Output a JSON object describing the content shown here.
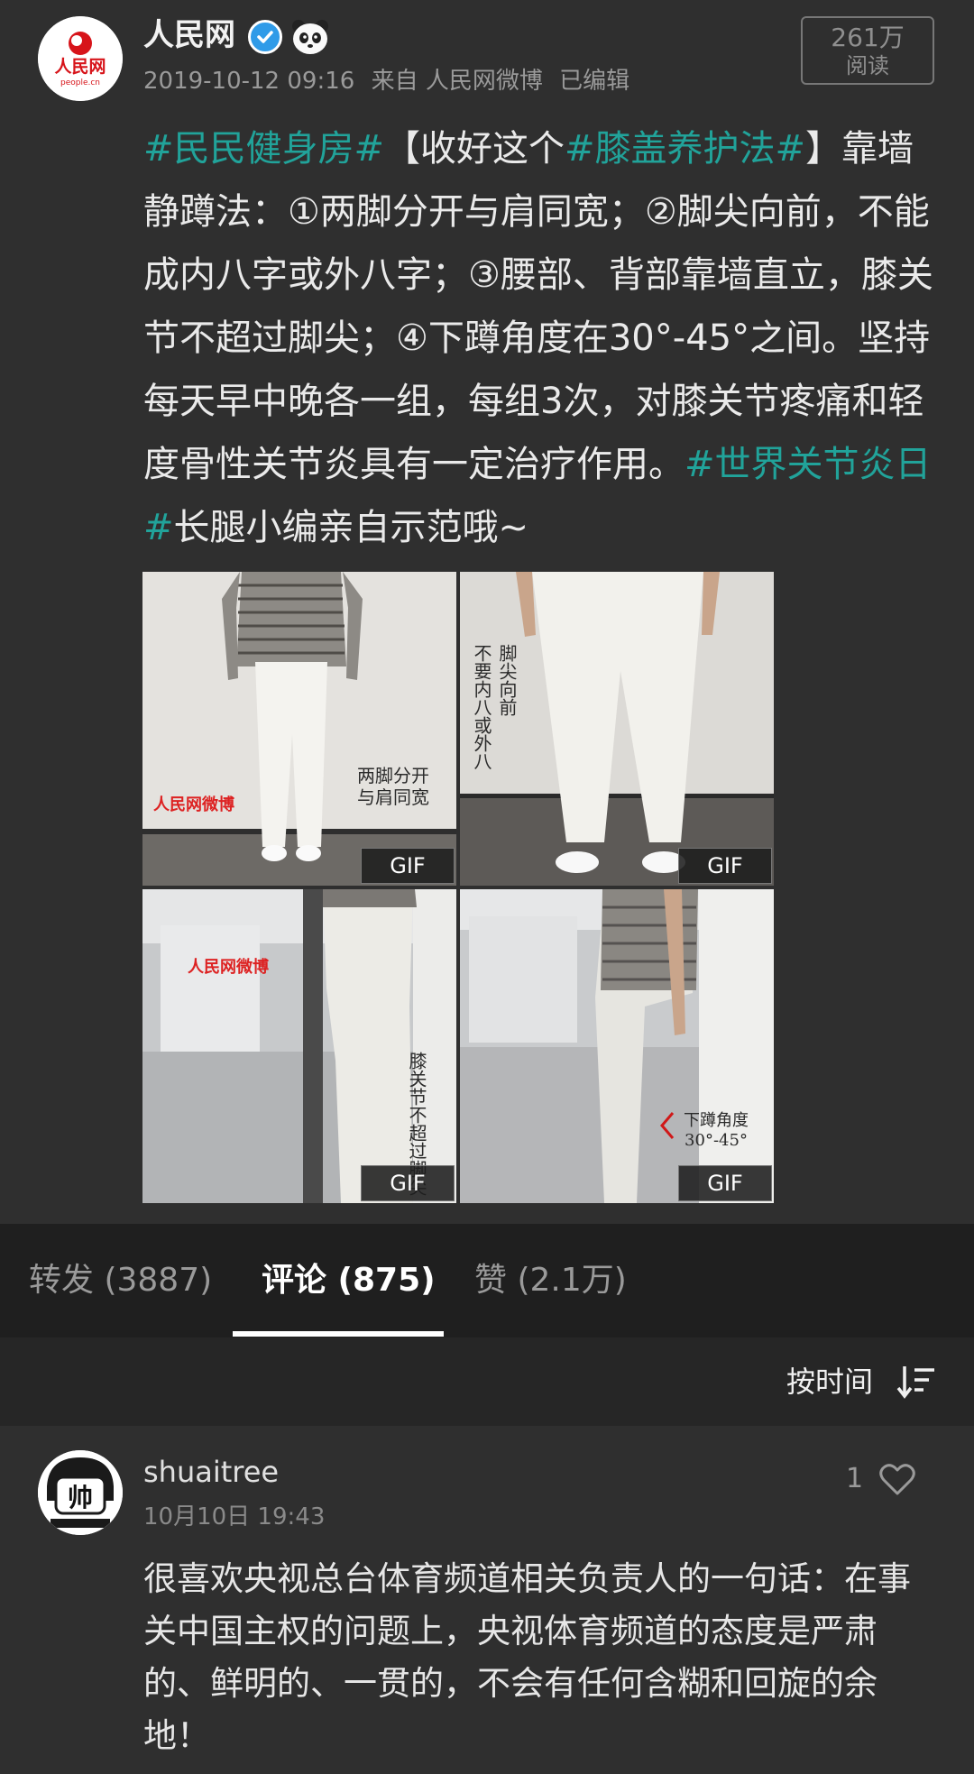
{
  "post": {
    "author": "人民网",
    "avatar_logo_text": "人民网",
    "avatar_logo_sub": "people.cn",
    "timestamp": "2019-10-12 09:16",
    "source": "来自 人民网微博",
    "edited": "已编辑",
    "reads_count": "261万",
    "reads_label": "阅读",
    "body_segments": [
      {
        "type": "tag",
        "text": "#民民健身房#"
      },
      {
        "type": "text",
        "text": "【收好这个"
      },
      {
        "type": "tag",
        "text": "#膝盖养护法#"
      },
      {
        "type": "text",
        "text": "】靠墙静蹲法：①两脚分开与肩同宽；②脚尖向前，不能成内八字或外八字；③腰部、背部靠墙直立，膝关节不超过脚尖；④下蹲角度在30°-45°之间。坚持每天早中晚各一组，每组3次，对膝关节疼痛和轻度骨性关节炎具有一定治疗作用。"
      },
      {
        "type": "tag",
        "text": "#世界关节炎日#"
      },
      {
        "type": "text",
        "text": "长腿小编亲自示范哦~"
      }
    ],
    "images": [
      {
        "badge": "GIF",
        "caption_lines": [
          "两脚分开",
          "与肩同宽"
        ],
        "watermark": "人民网微博"
      },
      {
        "badge": "GIF",
        "caption_lines": [
          "脚尖向前",
          "不要内八或外八"
        ]
      },
      {
        "badge": "GIF",
        "caption_lines": [
          "膝关节不超过脚尖"
        ],
        "watermark": "人民网微博"
      },
      {
        "badge": "GIF",
        "caption_lines": [
          "下蹲角度",
          "30°-45°"
        ]
      }
    ]
  },
  "tabs": [
    {
      "label": "转发 (3887)",
      "active": false
    },
    {
      "label": "评论 (875)",
      "active": true
    },
    {
      "label": "赞 (2.1万)",
      "active": false
    }
  ],
  "sort": {
    "label": "按时间"
  },
  "comment": {
    "avatar_text": "帅",
    "user": "shuaitree",
    "time": "10月10日 19:43",
    "likes": "1",
    "text": "很喜欢央视总台体育频道相关负责人的一句话：在事关中国主权的问题上，央视体育频道的态度是严肃的、鲜明的、一贯的，不会有任何含糊和回旋的余地！"
  },
  "colors": {
    "background": "#2f2f2f",
    "tag": "#21a39a",
    "tab_bar": "#1f1f1f",
    "sort_row": "#262626"
  }
}
